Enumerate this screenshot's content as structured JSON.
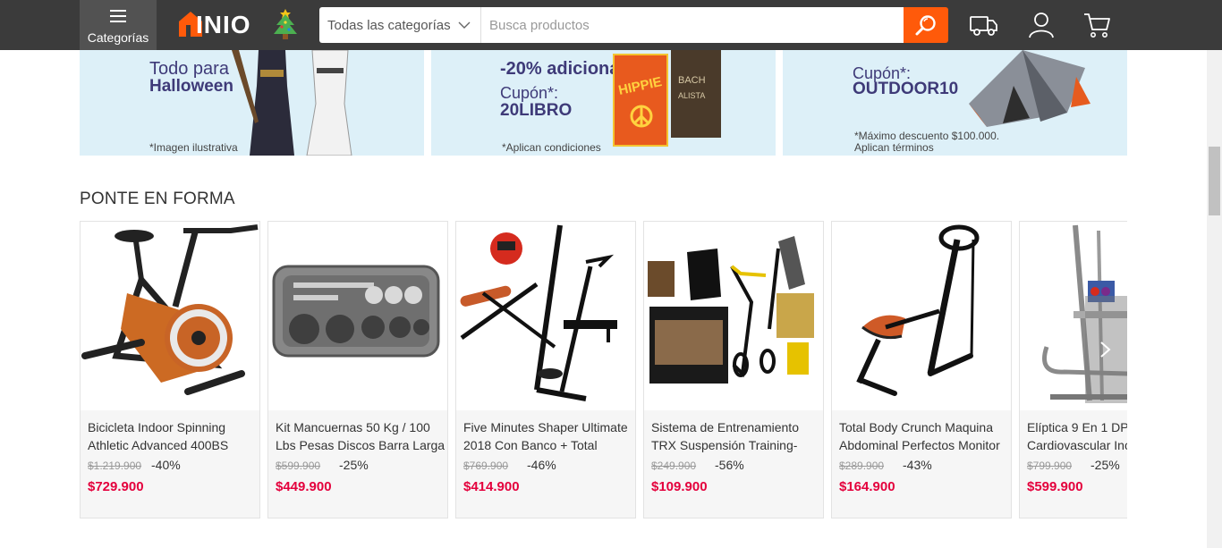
{
  "header": {
    "categories_label": "Categorías",
    "logo_text": "INIO",
    "category_select": "Todas las categorías",
    "search_placeholder": "Busca productos"
  },
  "banners": [
    {
      "line1": "Todo para",
      "line2": "Halloween",
      "note": "*Imagen ilustrativa"
    },
    {
      "line1": "-20% adicional",
      "line2": "Cupón*:",
      "line3": "20LIBRO",
      "note": "*Aplican condiciones",
      "book_title": "HIPPIE",
      "book_side": "BACH",
      "book_side2": "ALISTA"
    },
    {
      "line1": "Cupón*:",
      "line2": "OUTDOOR10",
      "note1": "*Máximo descuento $100.000.",
      "note2": "Aplican términos"
    }
  ],
  "section": {
    "title": "PONTE EN FORMA"
  },
  "products": [
    {
      "line1": "Bicicleta Indoor Spinning",
      "line2": "Athletic Advanced 400BS",
      "old_price": "$1.219.900",
      "discount": "-40%",
      "price": "$729.900"
    },
    {
      "line1": "Kit Mancuernas 50 Kg / 100",
      "line2": "Lbs Pesas Discos Barra Larga",
      "old_price": "$599.900",
      "discount": "-25%",
      "price": "$449.900"
    },
    {
      "line1": "Five Minutes Shaper Ultimate",
      "line2": "2018 Con Banco + Total",
      "old_price": "$769.900",
      "discount": "-46%",
      "price": "$414.900"
    },
    {
      "line1": "Sistema de Entrenamiento",
      "line2": "TRX Suspensión Training-",
      "old_price": "$249.900",
      "discount": "-56%",
      "price": "$109.900"
    },
    {
      "line1": "Total Body Crunch Maquina",
      "line2": "Abdominal Perfectos Monitor",
      "old_price": "$289.900",
      "discount": "-43%",
      "price": "$164.900"
    },
    {
      "line1": "Elíptica 9 En 1 DP",
      "line2": "Cardiovascular Inc",
      "old_price": "$799.900",
      "discount": "-25%",
      "price": "$599.900"
    }
  ],
  "colors": {
    "header_bg": "#3b3b3b",
    "accent": "#ff5a0a",
    "price": "#e4003c"
  }
}
